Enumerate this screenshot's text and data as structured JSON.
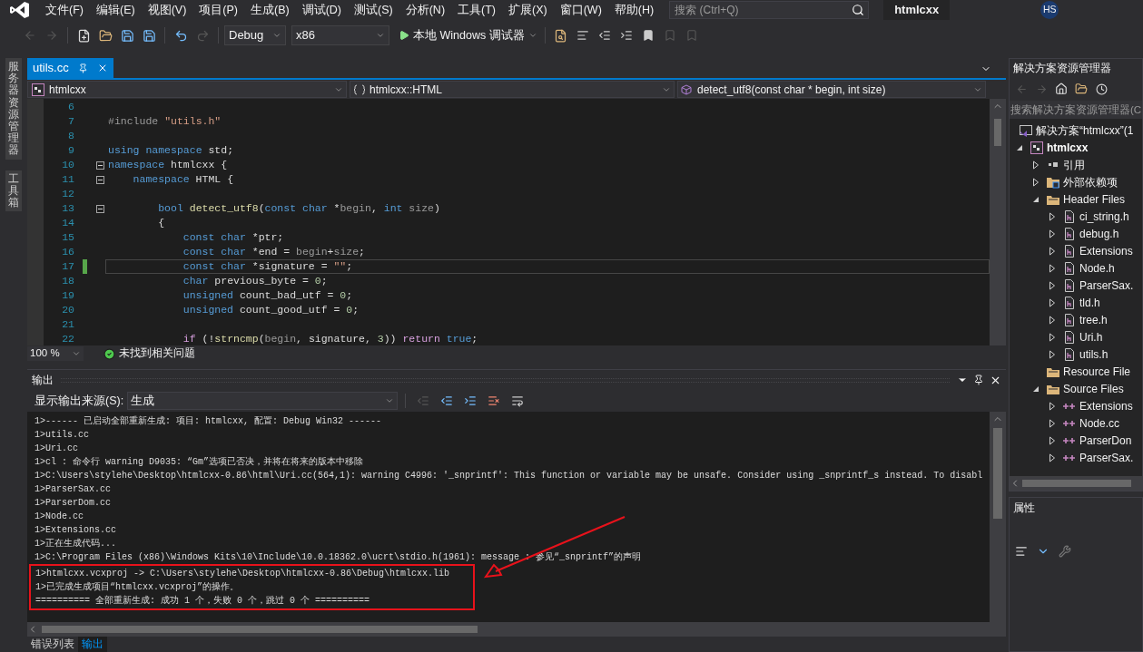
{
  "menu_bar": {
    "items": [
      "文件(F)",
      "编辑(E)",
      "视图(V)",
      "项目(P)",
      "生成(B)",
      "调试(D)",
      "测试(S)",
      "分析(N)",
      "工具(T)",
      "扩展(X)",
      "窗口(W)",
      "帮助(H)"
    ],
    "search": {
      "placeholder": "搜索 (Ctrl+Q)"
    },
    "solution_title": "htmlcxx",
    "avatar": "HS"
  },
  "toolbar": {
    "configuration": "Debug",
    "platform": "x86",
    "run_label": "本地 Windows 调试器"
  },
  "side_tabs": [
    "服务器资源管理器",
    "工具箱"
  ],
  "editor": {
    "tabs": [
      {
        "label": "utils.cc",
        "selected": true
      }
    ],
    "nav": {
      "project": "htmlcxx",
      "scope": "htmlcxx::HTML",
      "member": "detect_utf8(const char * begin, int size)"
    },
    "lines": [
      {
        "number": "6",
        "foldable": false,
        "current": false,
        "modified": false
      },
      {
        "number": "7",
        "foldable": false,
        "current": false,
        "modified": false,
        "tokens": [
          {
            "kind": "pre",
            "text": "#include "
          },
          {
            "kind": "str",
            "text": "\"utils.h\""
          }
        ]
      },
      {
        "number": "8",
        "foldable": false,
        "current": false,
        "modified": false
      },
      {
        "number": "9",
        "foldable": false,
        "current": false,
        "modified": false,
        "tokens": [
          {
            "kind": "kw",
            "text": "using"
          },
          {
            "kind": "kw",
            "text": " namespace"
          },
          {
            "kind": "plain",
            "text": " std;"
          }
        ]
      },
      {
        "number": "10",
        "foldable": true,
        "current": false,
        "modified": false,
        "tokens": [
          {
            "kind": "kw",
            "text": "namespace"
          },
          {
            "kind": "plain",
            "text": " htmlcxx {"
          }
        ]
      },
      {
        "number": "11",
        "foldable": true,
        "current": false,
        "modified": false,
        "tokens": [
          {
            "kind": "kw",
            "text": "    namespace"
          },
          {
            "kind": "plain",
            "text": " HTML {"
          }
        ]
      },
      {
        "number": "12",
        "foldable": false,
        "current": false,
        "modified": false
      },
      {
        "number": "13",
        "foldable": true,
        "current": false,
        "modified": false,
        "tokens": [
          {
            "kind": "kw",
            "text": "        bool"
          },
          {
            "kind": "fn",
            "text": " detect_utf8"
          },
          {
            "kind": "plain",
            "text": "("
          },
          {
            "kind": "kw",
            "text": "const"
          },
          {
            "kind": "kw",
            "text": " char"
          },
          {
            "kind": "plain",
            "text": " *"
          },
          {
            "kind": "param",
            "text": "begin"
          },
          {
            "kind": "plain",
            "text": ", "
          },
          {
            "kind": "kw",
            "text": "int"
          },
          {
            "kind": "param",
            "text": " size"
          },
          {
            "kind": "plain",
            "text": ")"
          }
        ]
      },
      {
        "number": "14",
        "foldable": false,
        "current": false,
        "modified": false,
        "tokens": [
          {
            "kind": "plain",
            "text": "        {"
          }
        ]
      },
      {
        "number": "15",
        "foldable": false,
        "current": false,
        "modified": false,
        "tokens": [
          {
            "kind": "kw",
            "text": "            const"
          },
          {
            "kind": "kw",
            "text": " char"
          },
          {
            "kind": "plain",
            "text": " *ptr;"
          }
        ]
      },
      {
        "number": "16",
        "foldable": false,
        "current": false,
        "modified": false,
        "tokens": [
          {
            "kind": "kw",
            "text": "            const"
          },
          {
            "kind": "kw",
            "text": " char"
          },
          {
            "kind": "plain",
            "text": " *end = "
          },
          {
            "kind": "param",
            "text": "begin"
          },
          {
            "kind": "plain",
            "text": "+"
          },
          {
            "kind": "param",
            "text": "size"
          },
          {
            "kind": "plain",
            "text": ";"
          }
        ]
      },
      {
        "number": "17",
        "foldable": false,
        "current": true,
        "modified": true,
        "tokens": [
          {
            "kind": "kw",
            "text": "            const"
          },
          {
            "kind": "kw",
            "text": " char"
          },
          {
            "kind": "plain",
            "text": " *signature = "
          },
          {
            "kind": "str",
            "text": "\"\""
          },
          {
            "kind": "plain",
            "text": ";"
          }
        ]
      },
      {
        "number": "18",
        "foldable": false,
        "current": false,
        "modified": false,
        "tokens": [
          {
            "kind": "kw",
            "text": "            char"
          },
          {
            "kind": "plain",
            "text": " previous_byte = "
          },
          {
            "kind": "num",
            "text": "0"
          },
          {
            "kind": "plain",
            "text": ";"
          }
        ]
      },
      {
        "number": "19",
        "foldable": false,
        "current": false,
        "modified": false,
        "tokens": [
          {
            "kind": "kw",
            "text": "            unsigned"
          },
          {
            "kind": "plain",
            "text": " count_bad_utf = "
          },
          {
            "kind": "num",
            "text": "0"
          },
          {
            "kind": "plain",
            "text": ";"
          }
        ]
      },
      {
        "number": "20",
        "foldable": false,
        "current": false,
        "modified": false,
        "tokens": [
          {
            "kind": "kw",
            "text": "            unsigned"
          },
          {
            "kind": "plain",
            "text": " count_good_utf = "
          },
          {
            "kind": "num",
            "text": "0"
          },
          {
            "kind": "plain",
            "text": ";"
          }
        ]
      },
      {
        "number": "21",
        "foldable": false,
        "current": false,
        "modified": false
      },
      {
        "number": "22",
        "foldable": false,
        "current": false,
        "modified": false,
        "tokens": [
          {
            "kind": "ctrl",
            "text": "            if"
          },
          {
            "kind": "plain",
            "text": " (!"
          },
          {
            "kind": "fn",
            "text": "strncmp"
          },
          {
            "kind": "plain",
            "text": "("
          },
          {
            "kind": "param",
            "text": "begin"
          },
          {
            "kind": "plain",
            "text": ", signature, "
          },
          {
            "kind": "num",
            "text": "3"
          },
          {
            "kind": "plain",
            "text": ")) "
          },
          {
            "kind": "ctrl",
            "text": "return"
          },
          {
            "kind": "kw",
            "text": " true"
          },
          {
            "kind": "plain",
            "text": ";"
          }
        ]
      }
    ],
    "zoom": "100 %",
    "status": "未找到相关问题"
  },
  "output": {
    "title": "输出",
    "source_label": "显示输出来源(S):",
    "source": "生成",
    "lines": [
      "1>------ 已启动全部重新生成: 项目: htmlcxx, 配置: Debug Win32 ------",
      "1>utils.cc",
      "1>Uri.cc",
      "1>cl : 命令行 warning D9035: “Gm”选项已否决，并将在将来的版本中移除",
      "1>C:\\Users\\stylehe\\Desktop\\htmlcxx-0.86\\html\\Uri.cc(564,1): warning C4996: '_snprintf': This function or variable may be unsafe. Consider using _snprintf_s instead. To disabl",
      "1>ParserSax.cc",
      "1>ParserDom.cc",
      "1>Node.cc",
      "1>Extensions.cc",
      "1>正在生成代码...",
      "1>C:\\Program Files (x86)\\Windows Kits\\10\\Include\\10.0.18362.0\\ucrt\\stdio.h(1961): message : 参见“_snprintf”的声明"
    ],
    "boxed_lines": [
      "1>htmlcxx.vcxproj -> C:\\Users\\stylehe\\Desktop\\htmlcxx-0.86\\Debug\\htmlcxx.lib",
      "1>已完成生成项目“htmlcxx.vcxproj”的操作。",
      "========== 全部重新生成: 成功 1 个，失败 0 个，跳过 0 个 =========="
    ]
  },
  "bottom_tabs": [
    {
      "label": "错误列表",
      "selected": false
    },
    {
      "label": "输出",
      "selected": true
    }
  ],
  "solution_explorer": {
    "title": "解决方案资源管理器",
    "search": {
      "placeholder": "搜索解决方案资源管理器(C"
    },
    "tree": [
      {
        "label": "解决方案“htmlcxx”(1",
        "kind": "solution",
        "children": [
          {
            "label": "htmlcxx",
            "kind": "project",
            "expanded": true,
            "children": [
              {
                "label": "引用",
                "kind": "references",
                "expanded": false
              },
              {
                "label": "外部依赖项",
                "kind": "external",
                "expanded": false
              },
              {
                "label": "Header Files",
                "kind": "folder",
                "expanded": true,
                "children": [
                  {
                    "label": "ci_string.h",
                    "kind": "header",
                    "expanded": false
                  },
                  {
                    "label": "debug.h",
                    "kind": "header",
                    "expanded": false
                  },
                  {
                    "label": "Extensions",
                    "kind": "header",
                    "expanded": false
                  },
                  {
                    "label": "Node.h",
                    "kind": "header",
                    "expanded": false
                  },
                  {
                    "label": "ParserSax.",
                    "kind": "header",
                    "expanded": false
                  },
                  {
                    "label": "tld.h",
                    "kind": "header",
                    "expanded": false
                  },
                  {
                    "label": "tree.h",
                    "kind": "header",
                    "expanded": false
                  },
                  {
                    "label": "Uri.h",
                    "kind": "header",
                    "expanded": false
                  },
                  {
                    "label": "utils.h",
                    "kind": "header",
                    "expanded": false
                  }
                ]
              },
              {
                "label": "Resource File",
                "kind": "folder"
              },
              {
                "label": "Source Files",
                "kind": "folder",
                "expanded": true,
                "children": [
                  {
                    "label": "Extensions",
                    "kind": "source",
                    "expanded": false
                  },
                  {
                    "label": "Node.cc",
                    "kind": "source",
                    "expanded": false
                  },
                  {
                    "label": "ParserDon",
                    "kind": "source",
                    "expanded": false
                  },
                  {
                    "label": "ParserSax.",
                    "kind": "source",
                    "expanded": false
                  }
                ]
              }
            ]
          }
        ]
      }
    ]
  },
  "properties": {
    "title": "属性"
  }
}
